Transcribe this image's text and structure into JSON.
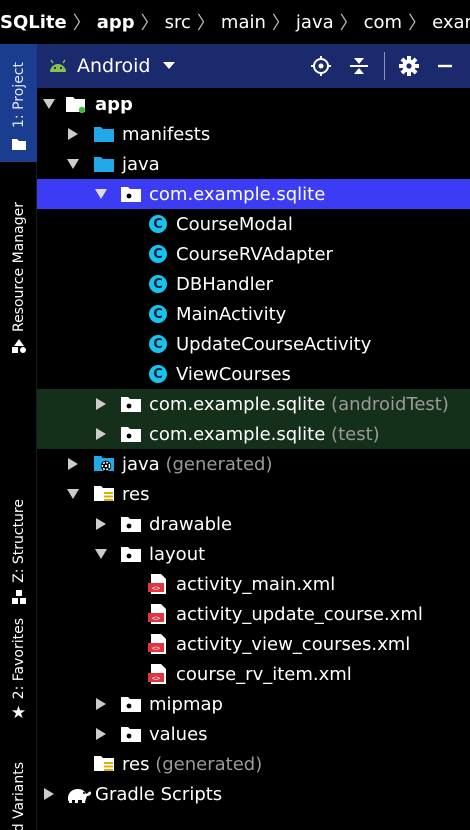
{
  "breadcrumb": {
    "items": [
      "SQLite",
      "app",
      "src",
      "main",
      "java",
      "com",
      "example"
    ]
  },
  "tool_strip": {
    "tabs": [
      {
        "label": "1: Project",
        "icon": "folder-icon"
      },
      {
        "label": "Resource Manager",
        "icon": "resource-manager-icon"
      },
      {
        "label": "Z: Structure",
        "icon": "structure-icon"
      },
      {
        "label": "2: Favorites",
        "icon": "star-icon"
      },
      {
        "label": "Build Variants",
        "icon": "none"
      }
    ]
  },
  "panel": {
    "view_selector": "Android",
    "buttons": [
      "locate-icon",
      "collapse-all-icon",
      "gear-icon",
      "minimize-icon"
    ]
  },
  "tree": {
    "app": "app",
    "manifests": "manifests",
    "java": "java",
    "package_main": "com.example.sqlite",
    "classes": [
      "CourseModal",
      "CourseRVAdapter",
      "DBHandler",
      "MainActivity",
      "UpdateCourseActivity",
      "ViewCourses"
    ],
    "package_android_test": {
      "name": "com.example.sqlite",
      "suffix": "(androidTest)"
    },
    "package_test": {
      "name": "com.example.sqlite",
      "suffix": "(test)"
    },
    "java_generated": {
      "name": "java",
      "suffix": "(generated)"
    },
    "res": "res",
    "drawable": "drawable",
    "layout": "layout",
    "layouts": [
      "activity_main.xml",
      "activity_update_course.xml",
      "activity_view_courses.xml",
      "course_rv_item.xml"
    ],
    "mipmap": "mipmap",
    "values": "values",
    "res_generated": {
      "name": "res",
      "suffix": "(generated)"
    },
    "gradle": "Gradle Scripts"
  },
  "colors": {
    "selection": "#3c3cf5",
    "test_bg": "#15301a",
    "panel_header": "#1a2a6c",
    "class_icon": "#16c4ee",
    "folder_blue": "#21a8e8",
    "xml_red": "#e0343f"
  }
}
